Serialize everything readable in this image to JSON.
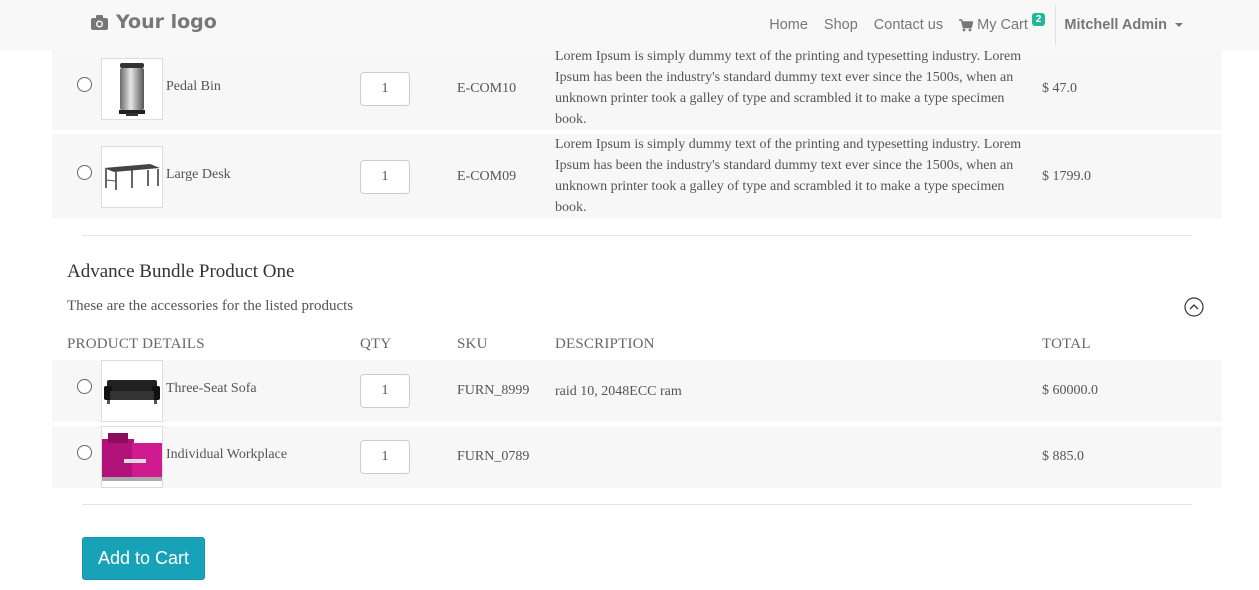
{
  "navbar": {
    "logo_text": "Your logo",
    "links": [
      "Home",
      "Shop",
      "Contact us"
    ],
    "cart_label": "My Cart",
    "cart_count": "2",
    "user_name": "Mitchell Admin"
  },
  "top_products": [
    {
      "name": "Pedal Bin",
      "qty": "1",
      "sku": "E-COM10",
      "description": "Lorem Ipsum is simply dummy text of the printing and typesetting industry. Lorem Ipsum has been the industry's standard dummy text ever since the 1500s, when an unknown printer took a galley of type and scrambled it to make a type specimen book.",
      "price": "$ 47.0"
    },
    {
      "name": "Large Desk",
      "qty": "1",
      "sku": "E-COM09",
      "description": "Lorem Ipsum is simply dummy text of the printing and typesetting industry. Lorem Ipsum has been the industry's standard dummy text ever since the 1500s, when an unknown printer took a galley of type and scrambled it to make a type specimen book.",
      "price": "$ 1799.0"
    }
  ],
  "bundle": {
    "title": "Advance Bundle Product One",
    "subtitle": "These are the accessories for the listed products",
    "headers": {
      "details": "PRODUCT DETAILS",
      "qty": "QTY",
      "sku": "SKU",
      "description": "DESCRIPTION",
      "total": "TOTAL"
    },
    "products": [
      {
        "name": "Three-Seat Sofa",
        "qty": "1",
        "sku": "FURN_8999",
        "description": "raid 10, 2048ECC ram",
        "price": "$ 60000.0"
      },
      {
        "name": "Individual Workplace",
        "qty": "1",
        "sku": "FURN_0789",
        "description": "",
        "price": "$ 885.0"
      }
    ]
  },
  "add_to_cart_label": "Add to Cart",
  "colors": {
    "accent": "#17a2b8",
    "badge": "#21b799",
    "row_bg": "#f7f7f7"
  }
}
